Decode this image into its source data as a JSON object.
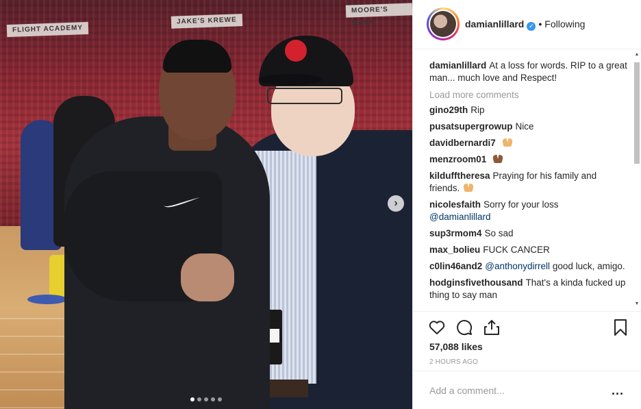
{
  "post": {
    "username": "damianlillard",
    "following_label": "Following",
    "caption": "At a loss for words. RIP to a great man... much love and Respect!",
    "load_more": "Load more comments",
    "likes": "57,088 likes",
    "time": "2 HOURS AGO",
    "add_comment_placeholder": "Add a comment...",
    "more_label": "...",
    "photo_count": 5,
    "photo_active_index": 0
  },
  "photo": {
    "banners": [
      "FLIGHT ACADEMY",
      "JAKE'S KREWE",
      "MOORE'S MARK"
    ]
  },
  "comments": [
    {
      "user": "gino29th",
      "text": "Rip"
    },
    {
      "user": "pusatsupergrowup",
      "text": "Nice"
    },
    {
      "user": "davidbernardi7",
      "text": "",
      "emoji": "praying-hands-icon"
    },
    {
      "user": "menzroom01",
      "text": "",
      "emoji": "praying-hands-dark-icon"
    },
    {
      "user": "kildufftheresa",
      "text": "Praying for his family and friends.",
      "emoji": "praying-hands-icon"
    },
    {
      "user": "nicolesfaith",
      "text": "Sorry for your loss",
      "mention": "@damianlillard"
    },
    {
      "user": "sup3rmom4",
      "text": "So sad"
    },
    {
      "user": "max_bolieu",
      "text": "FUCK CANCER"
    },
    {
      "user": "c0lin46and2",
      "mention": "@anthonydirrell",
      "text": "good luck, amigo."
    },
    {
      "user": "hodginsfivethousand",
      "text": "That's a kinda fucked up thing to say man"
    }
  ],
  "colors": {
    "verified": "#3897f0",
    "mention": "#003569",
    "muted": "#999999"
  }
}
